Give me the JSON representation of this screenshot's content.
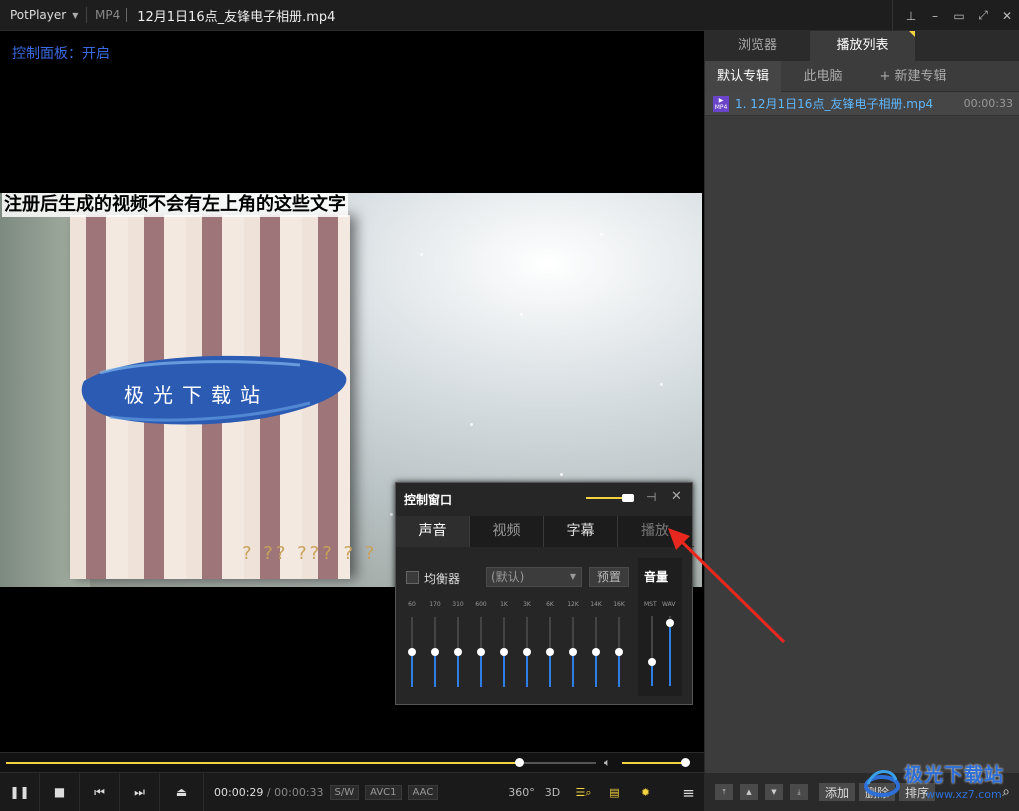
{
  "titlebar": {
    "app_name": "PotPlayer",
    "format": "MP4",
    "file_title": "12月1日16点_友锋电子相册.mp4",
    "controls": [
      "pin-icon",
      "minimize-icon",
      "maximize-icon",
      "fullscreen-icon",
      "close-icon"
    ]
  },
  "video": {
    "osd_text": "控制面板：开启",
    "watermark_text": "注册后生成的视频不会有左上角的这些文字",
    "overlay_brand": "极光下载站",
    "garbled_text": "? ?? ??? ? ?"
  },
  "seek": {
    "progress": 0.87,
    "volume": 0.95
  },
  "controlbar": {
    "time_current": "00:00:29",
    "time_sep": "/",
    "time_total": "00:00:33",
    "tags": [
      "S/W",
      "AVC1",
      "AAC"
    ],
    "icon_360": "360°",
    "icon_3d": "3D"
  },
  "panel": {
    "tabs": [
      "浏览器",
      "播放列表"
    ],
    "active_tab": 1,
    "subtabs": [
      "默认专辑",
      "此电脑",
      "+ 新建专辑"
    ],
    "playlist": [
      {
        "icon_label": "MP4",
        "name": "1. 12月1日16点_友锋电子相册.mp4",
        "duration": "00:00:33"
      }
    ],
    "bottom_buttons": [
      "添加",
      "删除",
      "排序"
    ]
  },
  "control_window": {
    "title": "控制窗口",
    "tabs": [
      "声音",
      "视频",
      "字幕",
      "播放"
    ],
    "active_tab": 0,
    "equalizer_label": "均衡器",
    "preset_value": "(默认)",
    "preset_button": "预置",
    "volume_title": "音量",
    "volume_labels": [
      "MST",
      "WAV"
    ],
    "volume_levels": [
      0.35,
      0.9
    ],
    "bands": [
      "60",
      "170",
      "310",
      "600",
      "1K",
      "3K",
      "6K",
      "12K",
      "14K",
      "16K"
    ],
    "band_levels": [
      0.5,
      0.5,
      0.5,
      0.5,
      0.5,
      0.5,
      0.5,
      0.5,
      0.5,
      0.5
    ]
  },
  "site_watermark": {
    "name": "极光下载站",
    "url": "www.xz7.com"
  },
  "colors": {
    "accent": "#f3d33f",
    "eq_fill": "#2f7ee6",
    "osd": "#3a6ae0",
    "playlist_text": "#5fb7ff"
  }
}
